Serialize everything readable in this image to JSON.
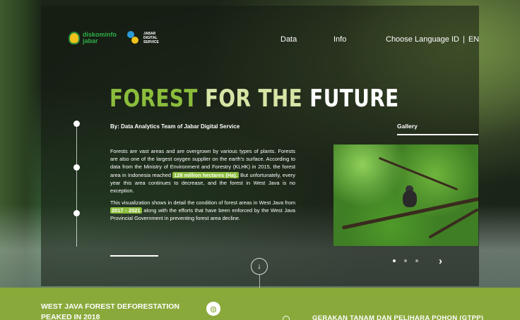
{
  "header": {
    "logo_left_text": "diskominfo jabar",
    "logo_right_text": "JABAR DIGITAL SERVICE",
    "nav": [
      {
        "label": "Data"
      },
      {
        "label": "Info"
      }
    ],
    "language": {
      "label": "Choose Language",
      "id": "ID",
      "separator": "|",
      "en": "EN"
    }
  },
  "hero": {
    "title_part1": "FOREST",
    "title_part2": "FOR THE",
    "title_part3": "FUTURE",
    "byline": "By: Data Analytics Team of Jabar Digital Service",
    "p1_a": "Forests are vast areas and are overgrown by various types of plants. Forests are also one of the largest oxygen supplier on the earth's surface. According to data from the Ministry of Environment and Forestry (KLHK) in 2015, the forest area in Indonesia reached ",
    "p1_hl": "128 million hectares (Ha).",
    "p1_b": " But unfortunately, every year this area continues to decrease, and the forest in West Java is no exception.",
    "p2_a": "This visualization shows in detail the condition of forest areas in West Java from ",
    "p2_hl": "2017 - 2021",
    "p2_b": " along with the efforts that have been enforced by the West Java Provincial Government in preventing forest area decline.",
    "scroll_icon": "arrow-down-icon"
  },
  "gallery": {
    "label": "Gallery",
    "image_alt": "monkey in forest canopy",
    "next_icon": "chevron-right-icon",
    "slides_count": 3,
    "active_slide": 1
  },
  "band": {
    "title": "WEST JAVA FOREST DEFORESTATION PEAKED IN 2018",
    "globe_icon": "globe-icon",
    "right_title": "GERAKAN TANAM DAN PELIHARA POHON (GTPP)",
    "color": "#8aa93b"
  },
  "colors": {
    "accent": "#8bbd3c",
    "accent_light": "#d7e5a6"
  }
}
